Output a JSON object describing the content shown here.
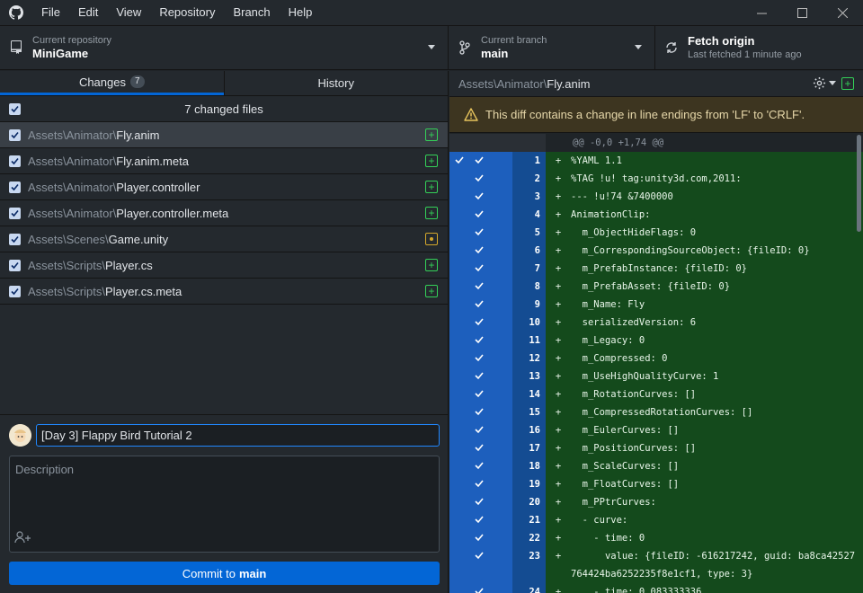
{
  "menu": [
    "File",
    "Edit",
    "View",
    "Repository",
    "Branch",
    "Help"
  ],
  "toolbar": {
    "repo_label": "Current repository",
    "repo_value": "MiniGame",
    "branch_label": "Current branch",
    "branch_value": "main",
    "fetch_label": "Fetch origin",
    "fetch_sub": "Last fetched 1 minute ago"
  },
  "tabs": {
    "changes": "Changes",
    "changes_count": "7",
    "history": "History"
  },
  "changes": {
    "header": "7 changed files",
    "files": [
      {
        "dir": "Assets\\Animator\\",
        "name": "Fly.anim",
        "status": "added"
      },
      {
        "dir": "Assets\\Animator\\",
        "name": "Fly.anim.meta",
        "status": "added"
      },
      {
        "dir": "Assets\\Animator\\",
        "name": "Player.controller",
        "status": "added"
      },
      {
        "dir": "Assets\\Animator\\",
        "name": "Player.controller.meta",
        "status": "added"
      },
      {
        "dir": "Assets\\Scenes\\",
        "name": "Game.unity",
        "status": "modified"
      },
      {
        "dir": "Assets\\Scripts\\",
        "name": "Player.cs",
        "status": "added"
      },
      {
        "dir": "Assets\\Scripts\\",
        "name": "Player.cs.meta",
        "status": "added"
      }
    ]
  },
  "commit": {
    "summary": "[Day 3] Flappy Bird Tutorial 2",
    "description_placeholder": "Description",
    "button_prefix": "Commit to",
    "button_branch": "main"
  },
  "diff": {
    "path_dir": "Assets\\Animator\\",
    "path_name": "Fly.anim",
    "warning": "This diff contains a change in line endings from 'LF' to 'CRLF'.",
    "hunk": "@@ -0,0 +1,74 @@",
    "lines": [
      {
        "n": "1",
        "text": "%YAML 1.1"
      },
      {
        "n": "2",
        "text": "%TAG !u! tag:unity3d.com,2011:"
      },
      {
        "n": "3",
        "text": "--- !u!74 &7400000"
      },
      {
        "n": "4",
        "text": "AnimationClip:"
      },
      {
        "n": "5",
        "text": "  m_ObjectHideFlags: 0"
      },
      {
        "n": "6",
        "text": "  m_CorrespondingSourceObject: {fileID: 0}"
      },
      {
        "n": "7",
        "text": "  m_PrefabInstance: {fileID: 0}"
      },
      {
        "n": "8",
        "text": "  m_PrefabAsset: {fileID: 0}"
      },
      {
        "n": "9",
        "text": "  m_Name: Fly"
      },
      {
        "n": "10",
        "text": "  serializedVersion: 6"
      },
      {
        "n": "11",
        "text": "  m_Legacy: 0"
      },
      {
        "n": "12",
        "text": "  m_Compressed: 0"
      },
      {
        "n": "13",
        "text": "  m_UseHighQualityCurve: 1"
      },
      {
        "n": "14",
        "text": "  m_RotationCurves: []"
      },
      {
        "n": "15",
        "text": "  m_CompressedRotationCurves: []"
      },
      {
        "n": "16",
        "text": "  m_EulerCurves: []"
      },
      {
        "n": "17",
        "text": "  m_PositionCurves: []"
      },
      {
        "n": "18",
        "text": "  m_ScaleCurves: []"
      },
      {
        "n": "19",
        "text": "  m_FloatCurves: []"
      },
      {
        "n": "20",
        "text": "  m_PPtrCurves:"
      },
      {
        "n": "21",
        "text": "  - curve:"
      },
      {
        "n": "22",
        "text": "    - time: 0"
      },
      {
        "n": "23",
        "text": "      value: {fileID: -616217242, guid: ba8ca42527764424ba6252235f8e1cf1, type: 3}"
      },
      {
        "n": "24",
        "text": "    - time: 0.083333336"
      }
    ]
  }
}
